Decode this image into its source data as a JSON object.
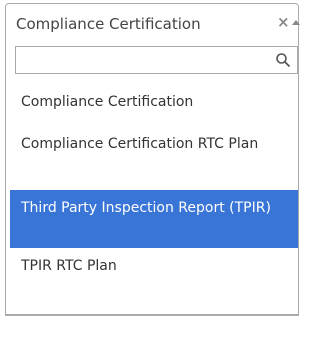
{
  "select": {
    "selected_label": "Compliance Certification",
    "clear_icon": "×",
    "arrow_icon": "chevron-up-icon"
  },
  "search": {
    "value": "",
    "placeholder": "",
    "icon": "search-icon"
  },
  "options": [
    {
      "label": "Compliance Certification",
      "highlighted": false
    },
    {
      "label": "Compliance Certification RTC Plan",
      "highlighted": false
    },
    {
      "label": "Third Party Inspection Report (TPIR)",
      "highlighted": true
    },
    {
      "label": "TPIR RTC Plan",
      "highlighted": false
    }
  ],
  "colors": {
    "highlight": "#3875d7",
    "border": "#aaaaaa",
    "text": "#333333"
  }
}
